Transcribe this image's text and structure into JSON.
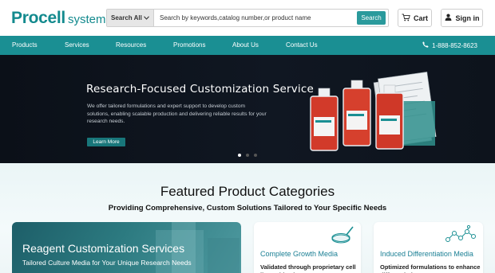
{
  "header": {
    "logo_main": "Procell",
    "logo_sub": "system",
    "logo_reg": "®",
    "search": {
      "scope": "Search All",
      "placeholder": "Search by keywords,catalog number,or product name",
      "button": "Search"
    },
    "cart_label": "Cart",
    "signin_label": "Sign in"
  },
  "nav": {
    "items": [
      "Products",
      "Services",
      "Resources",
      "Promotions",
      "About Us",
      "Contact Us"
    ],
    "phone": "1-888-852-8623"
  },
  "banner": {
    "title": "Research-Focused Customization Service",
    "description": "We offer tailored formulations and expert support to develop custom solutions, enabling scalable production and delivering reliable results for your research needs.",
    "button": "Learn More",
    "slides": 3,
    "active_slide": 1
  },
  "featured": {
    "title": "Featured Product Categories",
    "subtitle": "Providing Comprehensive, Custom Solutions Tailored to Your Specific Needs",
    "big_card": {
      "title": "Reagent Customization Services",
      "subtitle": "Tailored Culture Media for Your Unique Research Needs"
    },
    "cards": [
      {
        "title": "Complete Growth Media",
        "desc": "Validated through proprietary cell line cultivation",
        "icon": "petri-dish-icon"
      },
      {
        "title": "Induced Differentiation Media",
        "desc": "Optimized formulations to enhance differentiation",
        "icon": "molecule-icon"
      }
    ]
  },
  "colors": {
    "brand": "#138a8e",
    "nav_bg": "#1a8f93",
    "banner_bg": "#0f1520",
    "accent_text": "#1a7f94"
  }
}
